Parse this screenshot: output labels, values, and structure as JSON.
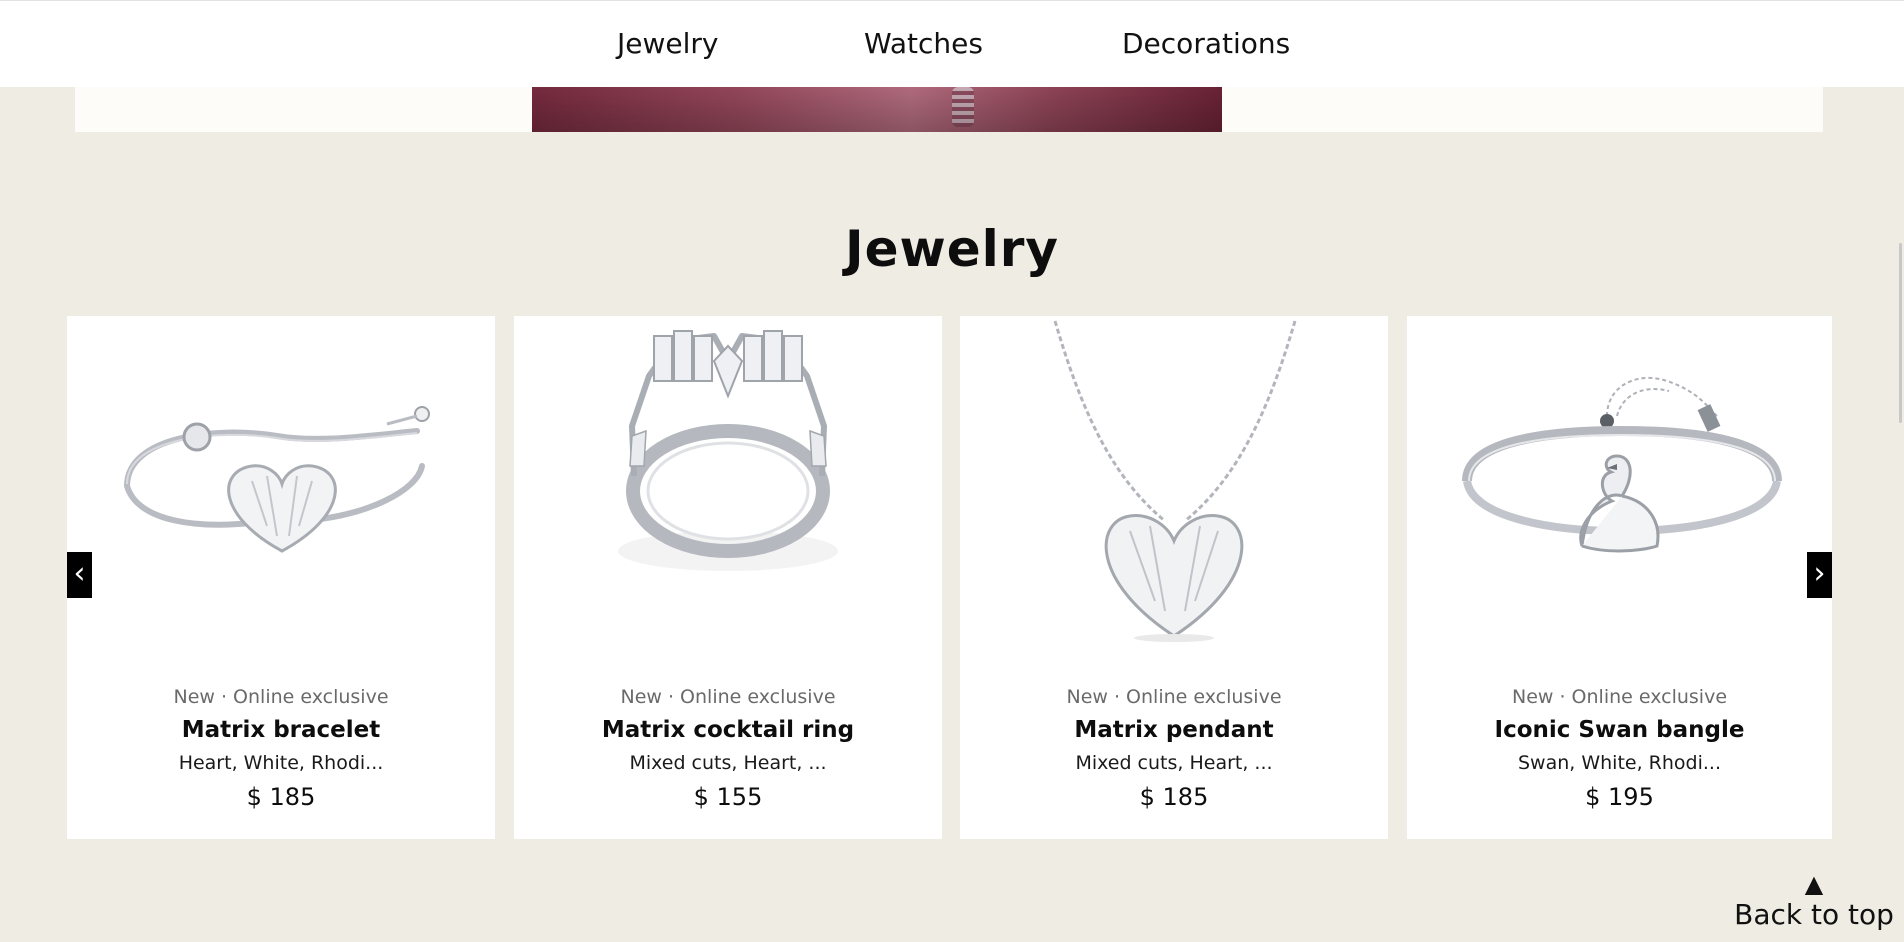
{
  "nav": {
    "items": [
      {
        "label": "Jewelry"
      },
      {
        "label": "Watches"
      },
      {
        "label": "Decorations"
      }
    ]
  },
  "section": {
    "title": "Jewelry"
  },
  "carousel": {
    "prev_icon": "‹",
    "next_icon": "›",
    "products": [
      {
        "tags": "New · Online exclusive",
        "name": "Matrix bracelet",
        "desc": "Heart, White, Rhodi...",
        "price": "$ 185",
        "image": "heart-bracelet-icon"
      },
      {
        "tags": "New · Online exclusive",
        "name": "Matrix cocktail ring",
        "desc": "Mixed cuts, Heart, ...",
        "price": "$ 155",
        "image": "cocktail-ring-icon"
      },
      {
        "tags": "New · Online exclusive",
        "name": "Matrix pendant",
        "desc": "Mixed cuts, Heart, ...",
        "price": "$ 185",
        "image": "heart-pendant-icon"
      },
      {
        "tags": "New · Online exclusive",
        "name": "Iconic Swan bangle",
        "desc": "Swan, White, Rhodi...",
        "price": "$ 195",
        "image": "swan-bangle-icon"
      }
    ]
  },
  "footer": {
    "back_to_top": "Back to top",
    "back_to_top_icon": "▲"
  },
  "colors": {
    "page_bg": "#efece4",
    "card_bg": "#ffffff",
    "accent": "#000000"
  }
}
